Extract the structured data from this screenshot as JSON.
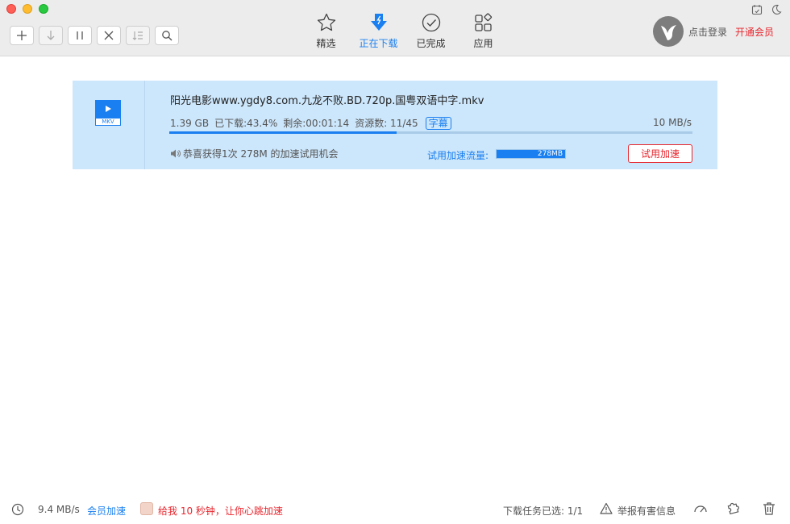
{
  "toolbar": {
    "nav": [
      {
        "label": "精选",
        "icon": "star-icon"
      },
      {
        "label": "正在下载",
        "icon": "download-icon",
        "active": true
      },
      {
        "label": "已完成",
        "icon": "check-circle-icon"
      },
      {
        "label": "应用",
        "icon": "apps-icon"
      }
    ],
    "login_label": "点击登录",
    "vip_label": "开通会员"
  },
  "task": {
    "file_type": "MKV",
    "name": "阳光电影www.ygdy8.com.九龙不败.BD.720p.国粤双语中字.mkv",
    "size": "1.39 GB",
    "downloaded": "已下载:43.4%",
    "progress": 0.434,
    "remaining": "剩余:00:01:14",
    "resources": "资源数: 11/45",
    "subtitle_tag": "字幕",
    "speed": "10 MB/s",
    "notice": "恭喜获得1次 278M 的加速试用机会",
    "trial_label": "试用加速流量:",
    "trial_amount": "278MB",
    "trial_button": "试用加速"
  },
  "status": {
    "speed": "9.4 MB/s",
    "vip_boost": "会员加速",
    "ad_text": "给我 10 秒钟，让你心跳加速",
    "selected": "下载任务已选: 1/1",
    "report": "举报有害信息"
  },
  "colors": {
    "accent": "#1a7ff0",
    "vip_red": "#e8262d",
    "task_bg": "#cce6fb",
    "toolbar_bg": "#ececec"
  }
}
